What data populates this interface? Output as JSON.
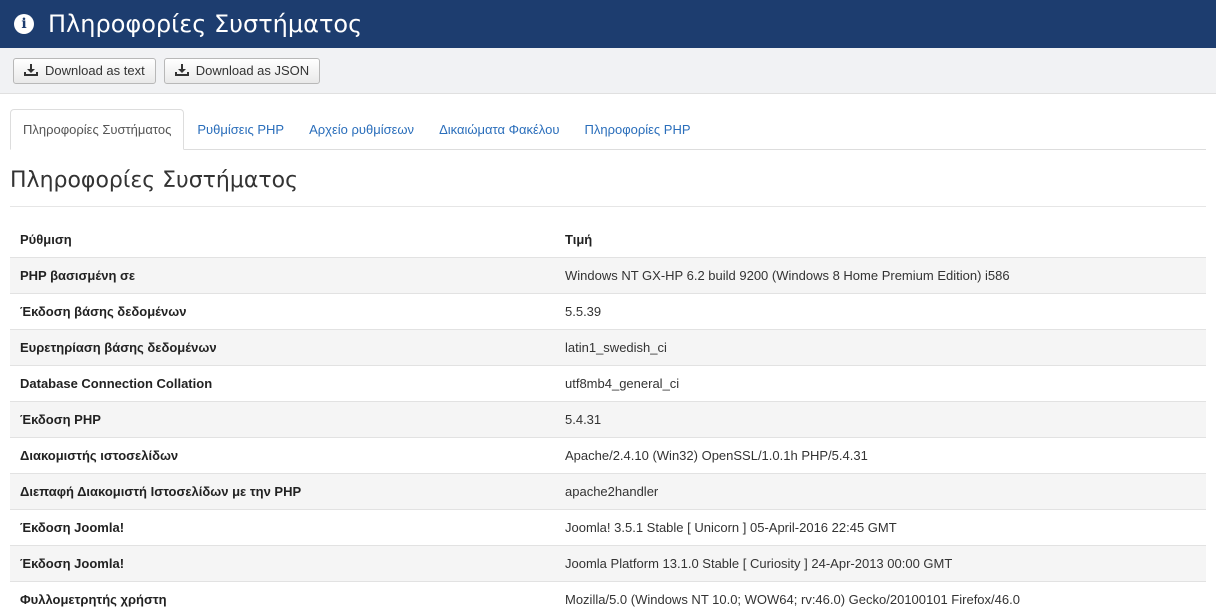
{
  "header": {
    "title": "Πληροφορίες Συστήματος",
    "icon": "info-icon",
    "background": "#1d3d6f"
  },
  "toolbar": {
    "download_text_label": "Download as text",
    "download_json_label": "Download as JSON"
  },
  "tabs": [
    {
      "label": "Πληροφορίες Συστήματος",
      "active": true
    },
    {
      "label": "Ρυθμίσεις PHP",
      "active": false
    },
    {
      "label": "Αρχείο ρυθμίσεων",
      "active": false
    },
    {
      "label": "Δικαιώματα Φακέλου",
      "active": false
    },
    {
      "label": "Πληροφορίες PHP",
      "active": false
    }
  ],
  "section": {
    "title": "Πληροφορίες Συστήματος"
  },
  "table": {
    "headers": [
      "Ρύθμιση",
      "Τιμή"
    ],
    "rows": [
      [
        "PHP βασισμένη σε",
        "Windows NT GX-HP 6.2 build 9200 (Windows 8 Home Premium Edition) i586"
      ],
      [
        "Έκδοση βάσης δεδομένων",
        "5.5.39"
      ],
      [
        "Ευρετηρίαση βάσης δεδομένων",
        "latin1_swedish_ci"
      ],
      [
        "Database Connection Collation",
        "utf8mb4_general_ci"
      ],
      [
        "Έκδοση PHP",
        "5.4.31"
      ],
      [
        "Διακομιστής ιστοσελίδων",
        "Apache/2.4.10 (Win32) OpenSSL/1.0.1h PHP/5.4.31"
      ],
      [
        "Διεπαφή Διακομιστή Ιστοσελίδων με την PHP",
        "apache2handler"
      ],
      [
        "Έκδοση Joomla!",
        "Joomla! 3.5.1 Stable [ Unicorn ] 05-April-2016 22:45 GMT"
      ],
      [
        "Έκδοση Joomla!",
        "Joomla Platform 13.1.0 Stable [ Curiosity ] 24-Apr-2013 00:00 GMT"
      ],
      [
        "Φυλλομετρητής χρήστη",
        "Mozilla/5.0 (Windows NT 10.0; WOW64; rv:46.0) Gecko/20100101 Firefox/46.0"
      ]
    ]
  }
}
